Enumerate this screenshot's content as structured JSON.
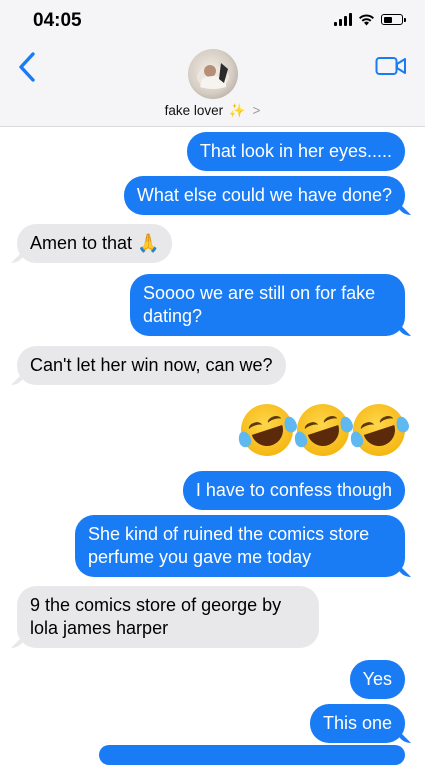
{
  "status": {
    "time": "04:05"
  },
  "contact": {
    "name": "fake lover",
    "sparkle": "✨",
    "chevron": ">"
  },
  "messages": [
    {
      "dir": "sent",
      "text": "That look in her eyes....."
    },
    {
      "dir": "sent",
      "text": "What else could we have done?"
    },
    {
      "dir": "recv",
      "text": "Amen to that 🙏"
    },
    {
      "dir": "sent",
      "text": "Soooo we are still on for fake dating?"
    },
    {
      "dir": "recv",
      "text": "Can't let her win now, can we?"
    },
    {
      "dir": "sent",
      "text": "I have to confess though"
    },
    {
      "dir": "sent",
      "text": "She kind of ruined the comics store perfume you gave me today"
    },
    {
      "dir": "recv",
      "text": "9 the comics store of george by lola james harper"
    },
    {
      "dir": "sent",
      "text": "Yes"
    },
    {
      "dir": "sent",
      "text": "This one"
    }
  ],
  "emoji_reaction": {
    "name": "rolling-on-floor-laughing",
    "count": 3
  },
  "colors": {
    "sent": "#1a7cf5",
    "received": "#e8e8ea",
    "accent": "#1a7cf5"
  },
  "icons": {
    "back": "chevron-left-icon",
    "video": "video-camera-icon"
  }
}
